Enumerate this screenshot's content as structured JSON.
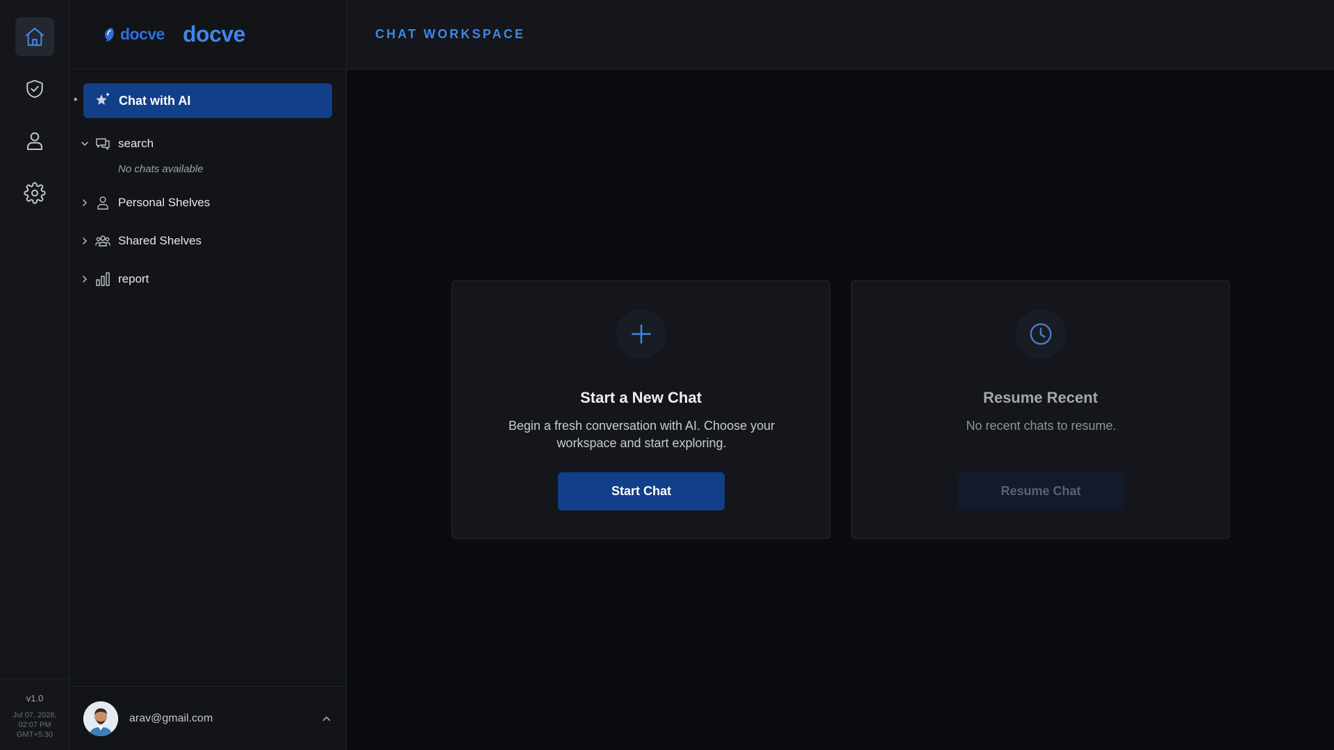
{
  "app": {
    "logo_text": "docve",
    "brand_name": "docve",
    "version": "v1.0",
    "datetime_lines": [
      "Jul 07, 2026,",
      "02:07 PM",
      "GMT+5:30"
    ]
  },
  "colors": {
    "accent": "#3f86e8",
    "primary_button": "#123f8a",
    "background": "#0b0c0f"
  },
  "rail": {
    "items": [
      {
        "name": "home",
        "icon": "home-icon",
        "active": true
      },
      {
        "name": "shield",
        "icon": "shield-check-icon",
        "active": false
      },
      {
        "name": "profile",
        "icon": "user-icon",
        "active": false
      },
      {
        "name": "settings",
        "icon": "gear-icon",
        "active": false
      }
    ]
  },
  "sidebar": {
    "active_item": {
      "label": "Chat with AI",
      "icon": "sparkle-star-icon",
      "marker": "*"
    },
    "tree": [
      {
        "label": "search",
        "icon": "chat-bubbles-icon",
        "expanded": true,
        "empty_text": "No chats available"
      },
      {
        "label": "Personal Shelves",
        "icon": "user-icon",
        "expanded": false
      },
      {
        "label": "Shared Shelves",
        "icon": "users-group-icon",
        "expanded": false
      },
      {
        "label": "report",
        "icon": "bar-chart-icon",
        "expanded": false
      }
    ]
  },
  "user": {
    "email": "arav@gmail.com"
  },
  "header": {
    "title": "CHAT WORKSPACE"
  },
  "cards": {
    "new_chat": {
      "icon": "plus-icon",
      "title": "Start a New Chat",
      "description": "Begin a fresh conversation with AI. Choose your workspace and start exploring.",
      "button": "Start Chat"
    },
    "resume": {
      "icon": "clock-icon",
      "title": "Resume Recent",
      "description": "No recent chats to resume.",
      "button": "Resume Chat",
      "button_disabled": true
    }
  }
}
